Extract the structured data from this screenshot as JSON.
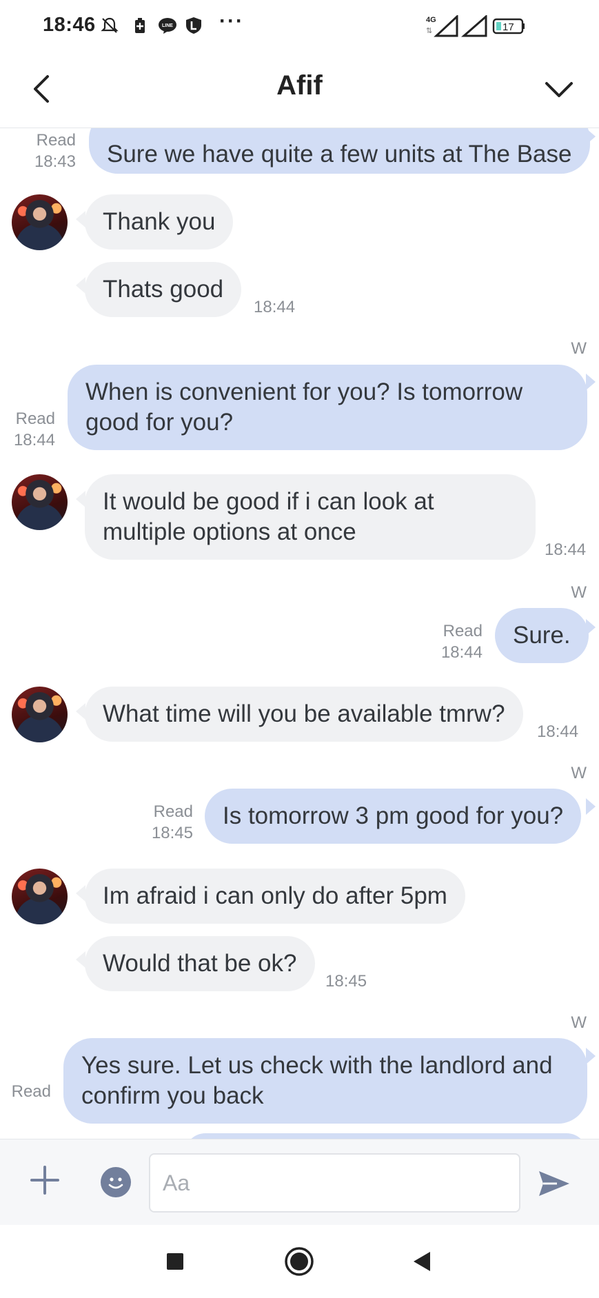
{
  "status_bar": {
    "time": "18:46",
    "network": "4G",
    "battery": "17"
  },
  "header": {
    "title": "Afif"
  },
  "messages": [
    {
      "dir": "out",
      "text": "Sure we have quite a few units at The Base",
      "read": "Read",
      "time": "18:43"
    },
    {
      "dir": "in",
      "text": "Thank you"
    },
    {
      "dir": "in",
      "text": "Thats good",
      "time": "18:44"
    },
    {
      "dir": "out",
      "sender": "W",
      "text": "When is convenient for you? Is tomorrow good for you?",
      "read": "Read",
      "time": "18:44"
    },
    {
      "dir": "in",
      "text": "It would be good if i can look at multiple options at once",
      "time": "18:44"
    },
    {
      "dir": "out",
      "sender": "W",
      "text": "Sure.",
      "read": "Read",
      "time": "18:44"
    },
    {
      "dir": "in",
      "text": "What time will you be available tmrw?",
      "time": "18:44"
    },
    {
      "dir": "out",
      "sender": "W",
      "text": "Is tomorrow 3 pm good for you?",
      "read": "Read",
      "time": "18:45"
    },
    {
      "dir": "in",
      "text": "Im afraid i can only do after 5pm"
    },
    {
      "dir": "in",
      "text": "Would that be ok?",
      "time": "18:45"
    },
    {
      "dir": "out",
      "sender": "W",
      "text": "Yes sure. Let us check with the landlord and confirm you back",
      "read": "Read"
    }
  ],
  "input": {
    "placeholder": "Aa"
  },
  "icons": {
    "back": "chevron-left-icon",
    "menu": "chevron-down-icon",
    "add": "plus-icon",
    "emoji": "smiley-icon",
    "send": "send-icon"
  },
  "colors": {
    "outgoing_bubble": "#d2ddf5",
    "incoming_bubble": "#f0f1f3",
    "accent_icon": "#727f9c"
  }
}
